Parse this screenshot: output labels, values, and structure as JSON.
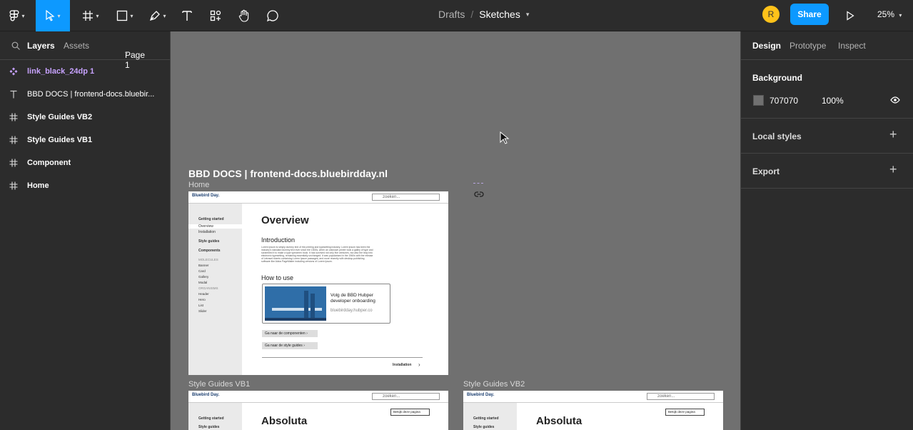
{
  "toolbar": {
    "breadcrumb": {
      "team": "Drafts",
      "separator": "/",
      "file": "Sketches"
    },
    "avatar_initial": "R",
    "share_label": "Share",
    "zoom": "25%",
    "tools": [
      "figma-menu",
      "move-tool",
      "frame-tool",
      "shape-tool",
      "pen-tool",
      "text-tool",
      "resources-tool",
      "hand-tool",
      "comment-tool"
    ]
  },
  "left_panel": {
    "tabs": {
      "layers": "Layers",
      "assets": "Assets",
      "page": "Page 1"
    },
    "layers": [
      {
        "icon": "component-icon",
        "name": "link_black_24dp 1",
        "color": "#c7a2ff"
      },
      {
        "icon": "text-icon",
        "name": "BBD DOCS | frontend-docs.bluebir...",
        "color": "#ffffff"
      },
      {
        "icon": "frame-icon",
        "name": "Style Guides VB2",
        "color": "#ffffff"
      },
      {
        "icon": "frame-icon",
        "name": "Style Guides VB1",
        "color": "#ffffff"
      },
      {
        "icon": "frame-icon",
        "name": "Component",
        "color": "#ffffff"
      },
      {
        "icon": "frame-icon",
        "name": "Home",
        "color": "#ffffff"
      }
    ]
  },
  "canvas": {
    "background": "#707070",
    "title_text": "BBD DOCS | frontend-docs.bluebirdday.nl",
    "frames": {
      "home": {
        "label": "Home",
        "logo": "Bluebird Day.",
        "search": "zoeken...",
        "nav": [
          "Getting started",
          "Overview",
          "Installation",
          "Style guides",
          "Components"
        ],
        "nav_groups": [
          "MOLECULES",
          "Banner",
          "Card",
          "Gallery",
          "Modal",
          "ORGANISMS",
          "Header",
          "Hero",
          "List",
          "Slider"
        ],
        "heading": "Overview",
        "intro_title": "Introduction",
        "intro_text": "Lorem Ipsum is simply dummy text of the printing and typesetting industry. Lorem Ipsum has been the industry's standard dummy text ever since the 1500s, when an unknown printer took a galley of type and scrambled it to make a type specimen book. It has survived not only five centuries, but also the leap into electronic typesetting, remaining essentially unchanged. It was popularised in the 1960s with the release of Letraset sheets containing Lorem Ipsum passages, and more recently with desktop publishing software like Aldus PageMaker including versions of Lorem Ipsum.",
        "how_title": "How to use",
        "card_title": "Volg de BBD Hubper developer onboarding",
        "card_link": "bluebirdday.hubper.co",
        "btn1": "Ga naar de componenten",
        "btn2": "Ga naar de style guides",
        "footer_next": "Installation"
      },
      "vb1": {
        "label": "Style Guides VB1",
        "logo": "Bluebird Day.",
        "search": "zoeken...",
        "nav": [
          "Getting started",
          "Style guides"
        ],
        "heading": "Absoluta",
        "button": "Bekijk deze pagina"
      },
      "vb2": {
        "label": "Style Guides VB2",
        "logo": "Bluebird Day.",
        "search": "zoeken...",
        "nav": [
          "Getting started",
          "Style guides"
        ],
        "heading": "Absoluta",
        "button": "Bekijk deze pagina"
      }
    }
  },
  "right_panel": {
    "tabs": {
      "design": "Design",
      "prototype": "Prototype",
      "inspect": "Inspect"
    },
    "background": {
      "title": "Background",
      "hex": "707070",
      "opacity": "100%",
      "swatch": "#707070"
    },
    "local_styles": "Local styles",
    "export": "Export"
  }
}
